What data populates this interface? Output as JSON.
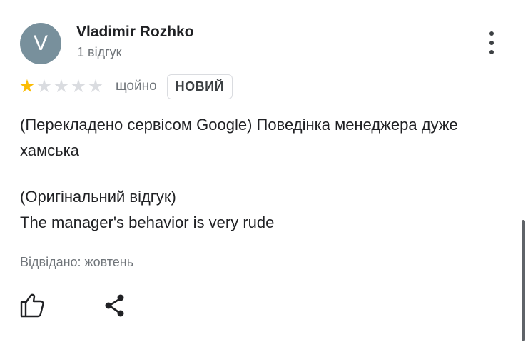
{
  "reviewer": {
    "initial": "V",
    "name": "Vladimir Rozhko",
    "reviews_count": "1 відгук"
  },
  "rating": {
    "stars": 1,
    "max_stars": 5,
    "time": "щойно",
    "badge": "НОВИЙ"
  },
  "review": {
    "translated_text": "(Перекладено сервісом Google) Поведінка менеджера дуже хамська",
    "original_label": "(Оригінальний відгук)",
    "original_text": "The manager's behavior is very rude",
    "visited": "Відвідано: жовтень"
  },
  "colors": {
    "star_filled": "#fbbc04",
    "star_empty": "#dadce0",
    "avatar_bg": "#78909c"
  },
  "icons": {
    "menu": "more-vert-icon",
    "like": "thumb-up-icon",
    "share": "share-icon"
  }
}
